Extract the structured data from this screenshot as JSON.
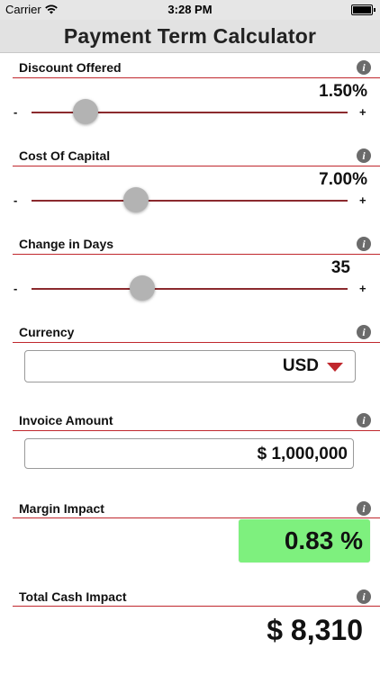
{
  "status_bar": {
    "carrier": "Carrier",
    "wifi_icon": "wifi-icon",
    "time": "3:28 PM",
    "battery_icon": "battery-icon"
  },
  "title": "Payment Term Calculator",
  "sections": {
    "discount": {
      "label": "Discount Offered",
      "value": "1.50%",
      "min_label": "-",
      "max_label": "+",
      "slider_level": 0.17
    },
    "cost_of_capital": {
      "label": "Cost Of Capital",
      "value": "7.00%",
      "min_label": "-",
      "max_label": "+",
      "slider_level": 0.33
    },
    "change_in_days": {
      "label": "Change in Days",
      "value": "35",
      "min_label": "-",
      "max_label": "+",
      "slider_level": 0.35
    },
    "currency": {
      "label": "Currency",
      "selected": "USD"
    },
    "invoice_amount": {
      "label": "Invoice Amount",
      "value": "$ 1,000,000"
    },
    "margin_impact": {
      "label": "Margin Impact",
      "value": "0.83 %"
    },
    "total_cash_impact": {
      "label": "Total Cash Impact",
      "value": "$ 8,310"
    }
  },
  "info_icon_glyph": "i",
  "colors": {
    "accent_red": "#c0272d",
    "margin_highlight": "#7ef07e",
    "title_bar": "#e2e2e2"
  }
}
